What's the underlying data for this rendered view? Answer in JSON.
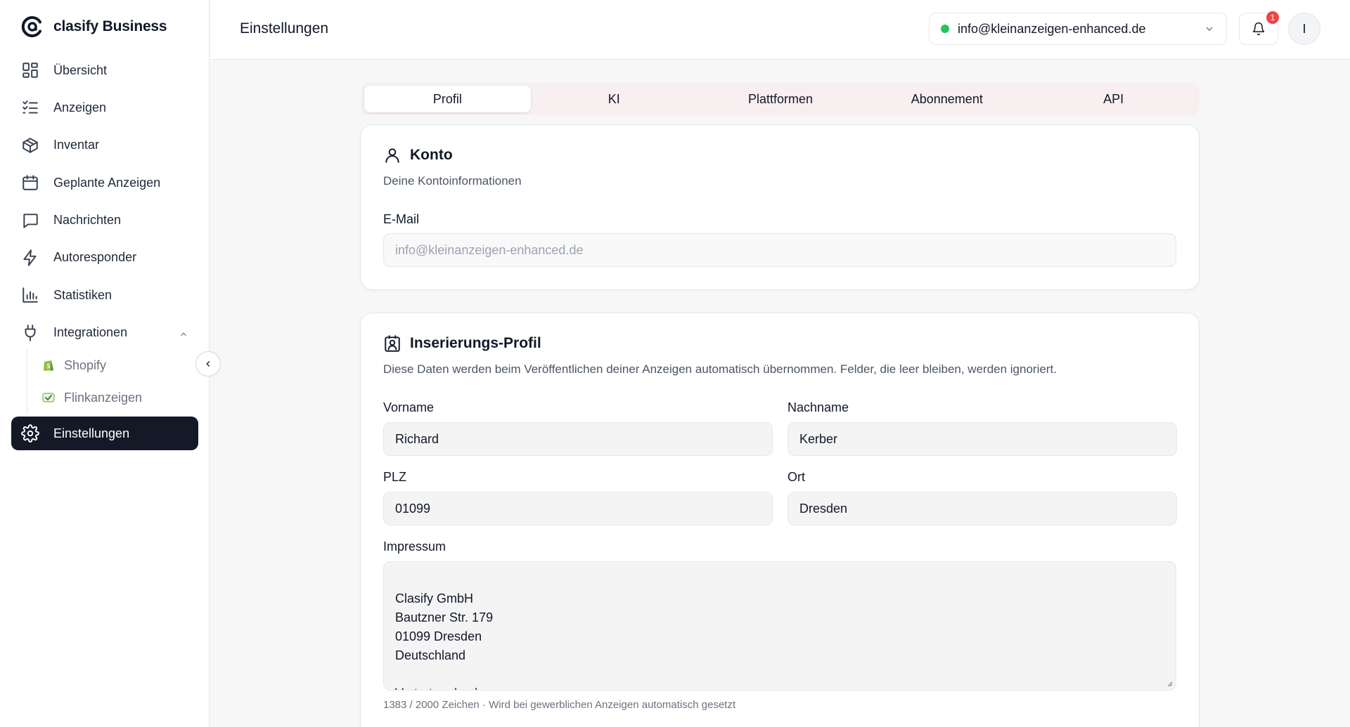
{
  "brand": {
    "name": "clasify Business"
  },
  "nav": {
    "items": [
      {
        "label": "Übersicht",
        "icon": "grid-icon"
      },
      {
        "label": "Anzeigen",
        "icon": "list-check-icon"
      },
      {
        "label": "Inventar",
        "icon": "box-icon"
      },
      {
        "label": "Geplante Anzeigen",
        "icon": "calendar-icon"
      },
      {
        "label": "Nachrichten",
        "icon": "chat-icon"
      },
      {
        "label": "Autoresponder",
        "icon": "bolt-icon"
      },
      {
        "label": "Statistiken",
        "icon": "bar-chart-icon"
      },
      {
        "label": "Integrationen",
        "icon": "plug-icon"
      }
    ],
    "sub_items": [
      {
        "label": "Shopify",
        "icon": "shopify-icon"
      },
      {
        "label": "Flinkanzeigen",
        "icon": "flinkanzeigen-icon"
      }
    ],
    "active": {
      "label": "Einstellungen",
      "icon": "gear-icon"
    }
  },
  "header": {
    "title": "Einstellungen",
    "account_email": "info@kleinanzeigen-enhanced.de",
    "status_color": "#22c55e",
    "notification_count": "1",
    "avatar_initial": "I"
  },
  "tabs": [
    {
      "label": "Profil",
      "active": true
    },
    {
      "label": "KI",
      "active": false
    },
    {
      "label": "Plattformen",
      "active": false
    },
    {
      "label": "Abonnement",
      "active": false
    },
    {
      "label": "API",
      "active": false
    }
  ],
  "account_card": {
    "title": "Konto",
    "description": "Deine Kontoinformationen",
    "email_label": "E-Mail",
    "email_value": "info@kleinanzeigen-enhanced.de"
  },
  "profile_card": {
    "title": "Inserierungs-Profil",
    "description": "Diese Daten werden beim Veröffentlichen deiner Anzeigen automatisch übernommen. Felder, die leer bleiben, werden ignoriert.",
    "firstname_label": "Vorname",
    "firstname_value": "Richard",
    "lastname_label": "Nachname",
    "lastname_value": "Kerber",
    "zip_label": "PLZ",
    "zip_value": "01099",
    "city_label": "Ort",
    "city_value": "Dresden",
    "imprint_label": "Impressum",
    "imprint_value": "Clasify GmbH\nBautzner Str. 179\n01099 Dresden\nDeutschland\n\nVertreten durch\nGeschäftsführer: Richard Kerber",
    "imprint_hint": "1383 / 2000 Zeichen · Wird bei gewerblichen Anzeigen automatisch gesetzt"
  }
}
